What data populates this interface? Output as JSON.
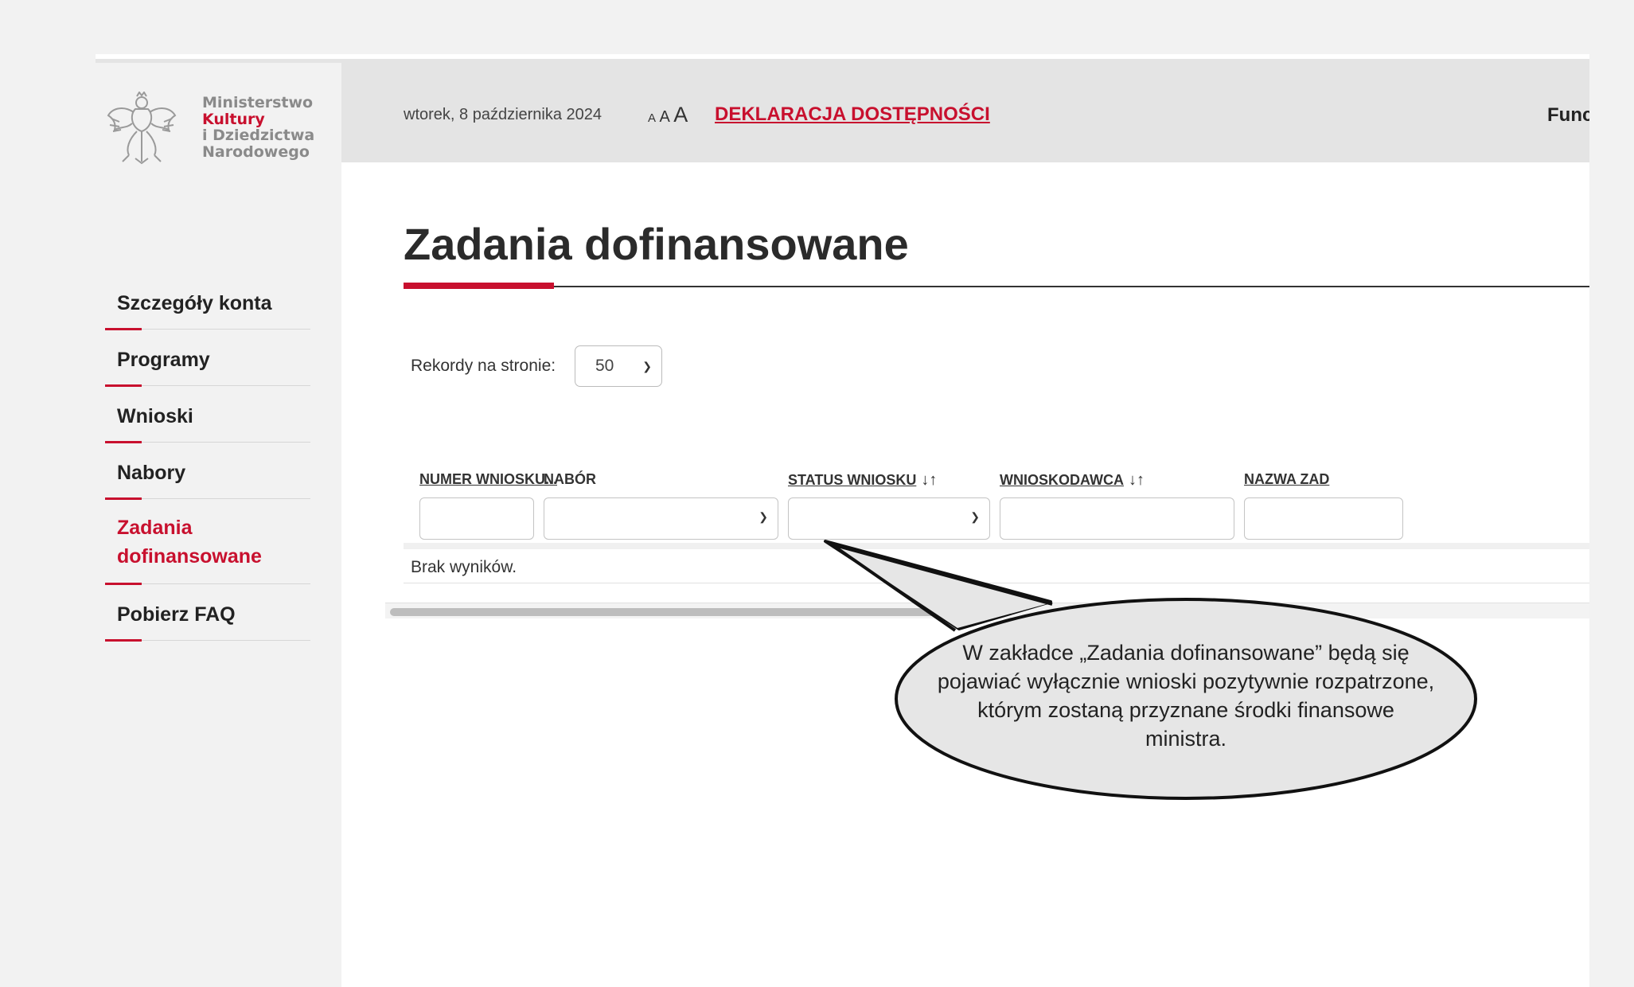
{
  "logo": {
    "line1": "Ministerstwo",
    "line2": "Kultury",
    "line3": "i Dziedzictwa",
    "line4": "Narodowego"
  },
  "sidebar": {
    "items": [
      {
        "label": "Szczegóły konta"
      },
      {
        "label": "Programy"
      },
      {
        "label": "Wnioski"
      },
      {
        "label": "Nabory"
      },
      {
        "label": "Zadania dofinansowane",
        "active": true
      },
      {
        "label": "Pobierz FAQ"
      }
    ]
  },
  "header": {
    "date": "wtorek, 8 października 2024",
    "font_small": "A",
    "font_medium": "A",
    "font_large": "A",
    "declaration_link": "DEKLARACJA DOSTĘPNOŚCI",
    "right_text": "Func"
  },
  "main": {
    "title": "Zadania dofinansowane",
    "records_label": "Rekordy na stronie:",
    "records_value": "50",
    "columns": [
      {
        "label": "NUMER WNIOSKU..."
      },
      {
        "label": "NABÓR"
      },
      {
        "label": "STATUS WNIOSKU",
        "sort": "↓↑"
      },
      {
        "label": "WNIOSKODAWCA",
        "sort": "↓↑"
      },
      {
        "label": "NAZWA ZAD"
      }
    ],
    "empty_message": "Brak wyników."
  },
  "callout": {
    "text": "W zakładce „Zadania dofinansowane” będą się pojawiać wyłącznie wnioski pozytywnie rozpatrzone, którym zostaną przyznane środki finansowe ministra."
  },
  "colors": {
    "accent": "#c8102e",
    "header_bg": "#e4e4e4",
    "sidebar_bg": "#f2f2f2"
  }
}
